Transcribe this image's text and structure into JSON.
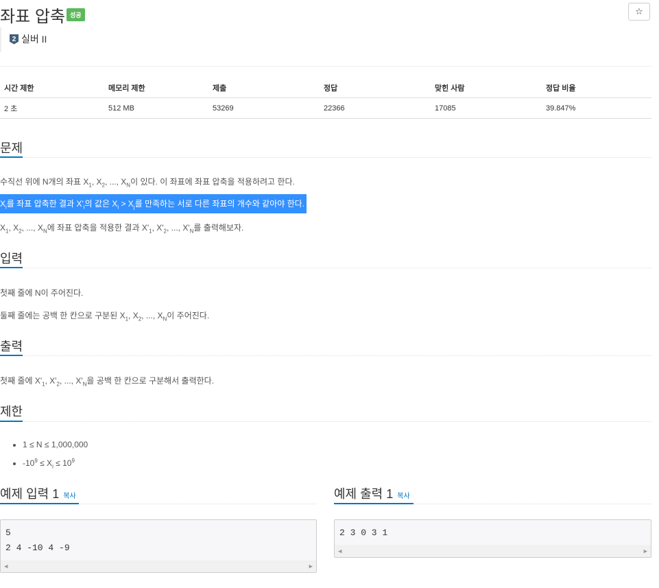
{
  "header": {
    "title": "좌표 압축",
    "badge": "성공",
    "star_icon": "☆",
    "tier_icon": "2",
    "tier": "실버 II"
  },
  "stats": {
    "headers": [
      "시간 제한",
      "메모리 제한",
      "제출",
      "정답",
      "맞힌 사람",
      "정답 비율"
    ],
    "values": [
      "2 초",
      "512 MB",
      "53269",
      "22366",
      "17085",
      "39.847%"
    ]
  },
  "problem": {
    "heading": "문제",
    "line1_pre": "수직선 위에 N개의 좌표 X",
    "line1_post": "이 있다. 이 좌표에 좌표 압축을 적용하려고 한다.",
    "line2_post": "를 만족하는 서로 다른 좌표의 개수와 같아야 한다.",
    "line2_a": "를 좌표 압축한 결과 X'",
    "line2_b": "의 값은 X",
    "line3_post": "에 좌표 압축을 적용한 결과 X'",
    "line3_end": "를 출력해보자."
  },
  "input": {
    "heading": "입력",
    "line1": "첫째 줄에 N이 주어진다.",
    "line2_pre": "둘째 줄에는 공백 한 칸으로 구분된 X",
    "line2_post": "이 주어진다."
  },
  "output": {
    "heading": "출력",
    "line1_pre": "첫째 줄에 X'",
    "line1_post": "을 공백 한 칸으로 구분해서 출력한다."
  },
  "limits": {
    "heading": "제한",
    "item1": "1 ≤ N ≤ 1,000,000",
    "item2_pre": "-10",
    "item2_mid": " ≤ X",
    "item2_post": " ≤ 10"
  },
  "example_input": {
    "heading": "예제 입력 1",
    "copy": "복사",
    "text": "5\n2 4 -10 4 -9"
  },
  "example_output": {
    "heading": "예제 출력 1",
    "copy": "복사",
    "text": "2 3 0 3 1"
  },
  "scroll": {
    "left": "◀",
    "right": "▶"
  },
  "colors": {
    "accent": "#0076c0",
    "badge": "#5cb85c",
    "highlight": "#3390ff"
  }
}
